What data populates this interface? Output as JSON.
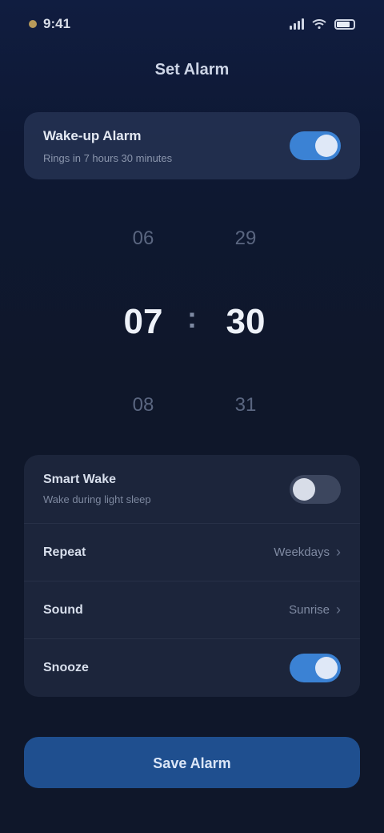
{
  "status_bar": {
    "time": "9:41"
  },
  "header": {
    "title": "Set Alarm"
  },
  "alarm_card": {
    "label": "Wake-up Alarm",
    "subtitle": "Rings in 7 hours 30 minutes",
    "enabled": true
  },
  "time_picker": {
    "hour_prev": "06",
    "hour": "07",
    "hour_next": "08",
    "separator": ":",
    "minute_prev": "29",
    "minute": "30",
    "minute_next": "31"
  },
  "options": {
    "smart_wake": {
      "label": "Smart Wake",
      "subtitle": "Wake during light sleep",
      "enabled": false
    },
    "repeat": {
      "label": "Repeat",
      "value": "Weekdays"
    },
    "sound": {
      "label": "Sound",
      "value": "Sunrise"
    },
    "snooze": {
      "label": "Snooze",
      "enabled": true
    }
  },
  "save_button": {
    "label": "Save Alarm"
  },
  "colors": {
    "accent": "#3b82d4",
    "background": "#0f172a",
    "button": "#1f4f8f"
  }
}
